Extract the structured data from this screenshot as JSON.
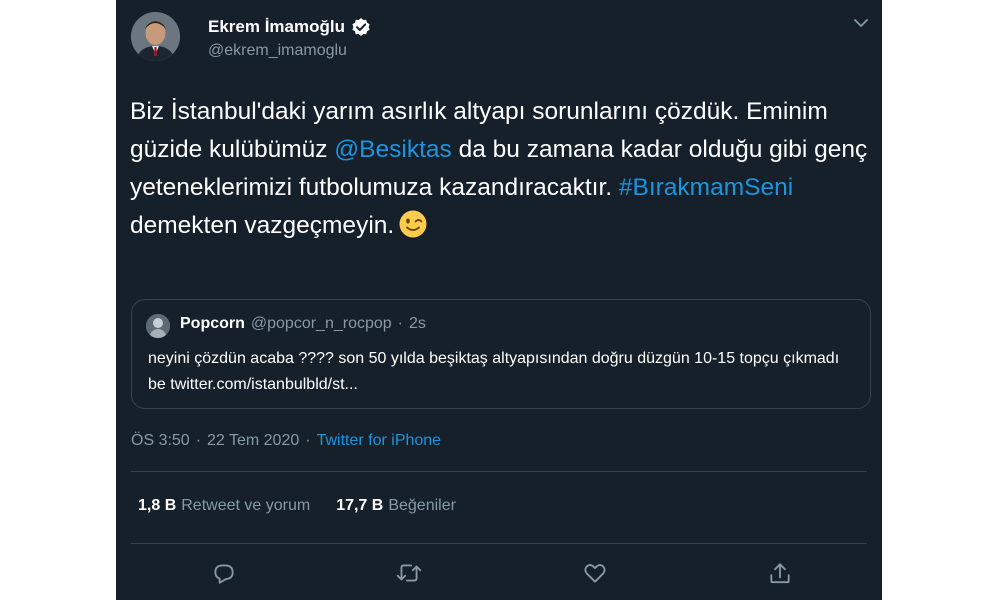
{
  "author": {
    "name": "Ekrem İmamoğlu",
    "handle": "@ekrem_imamoglu",
    "verified_icon": "verified-badge-icon"
  },
  "tweet": {
    "part1": "Biz İstanbul'daki yarım asırlık altyapı sorunlarını çözdük. Eminim güzide kulübümüz ",
    "mention": "@Besiktas",
    "part2": " da bu zamana kadar olduğu gibi genç yeteneklerimizi futbolumuza kazandıracaktır. ",
    "hashtag": "#BırakmamSeni",
    "part3": " demekten vazgeçmeyin.",
    "emoji": "winking-face-emoji"
  },
  "quote": {
    "name": "Popcorn",
    "handle": "@popcor_n_rocpop",
    "separator": "·",
    "time": "2s",
    "text": "neyini çözdün acaba ???? son 50 yılda beşiktaş altyapısından doğru düzgün 10-15 topçu çıkmadı be twitter.com/istanbulbld/st..."
  },
  "meta": {
    "time": "ÖS 3:50",
    "sep1": "·",
    "date": "22 Tem 2020",
    "sep2": "·",
    "source": "Twitter for iPhone"
  },
  "stats": {
    "retweets_count": "1,8 B",
    "retweets_label": "Retweet ve yorum",
    "likes_count": "17,7 B",
    "likes_label": "Beğeniler"
  },
  "colors": {
    "background": "#15202b",
    "link": "#1b95e0",
    "muted": "#8899a6",
    "border": "#38444d"
  }
}
